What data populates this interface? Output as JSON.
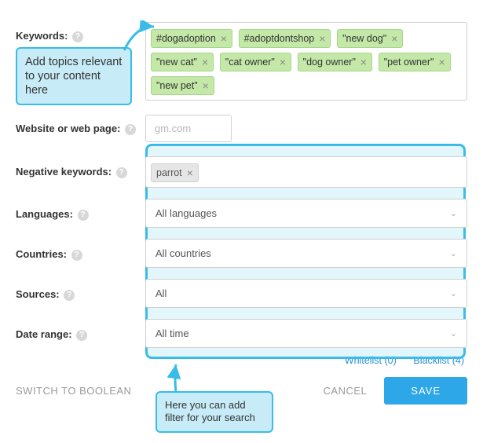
{
  "labels": {
    "keywords": "Keywords:",
    "website": "Website or web page:",
    "negative": "Negative keywords:",
    "languages": "Languages:",
    "countries": "Countries:",
    "sources": "Sources:",
    "daterange": "Date range:"
  },
  "keywords": {
    "tags": [
      "#dogadoption",
      "#adoptdontshop",
      "\"new dog\"",
      "\"new cat\"",
      "\"cat owner\"",
      "\"dog owner\"",
      "\"pet owner\"",
      "\"new pet\""
    ]
  },
  "website": {
    "placeholder": "gm.com"
  },
  "negative": {
    "tags": [
      "parrot"
    ]
  },
  "selects": {
    "languages": "All languages",
    "countries": "All countries",
    "sources": "All",
    "daterange": "All time"
  },
  "links": {
    "whitelist": "Whitelist (0)",
    "blacklist": "Blacklist (4)"
  },
  "footer": {
    "switch": "SWITCH TO BOOLEAN",
    "cancel": "CANCEL",
    "save": "SAVE"
  },
  "callouts": {
    "c1": "Add topics relevant to your content here",
    "c2": "Here you can add filter for your search"
  }
}
